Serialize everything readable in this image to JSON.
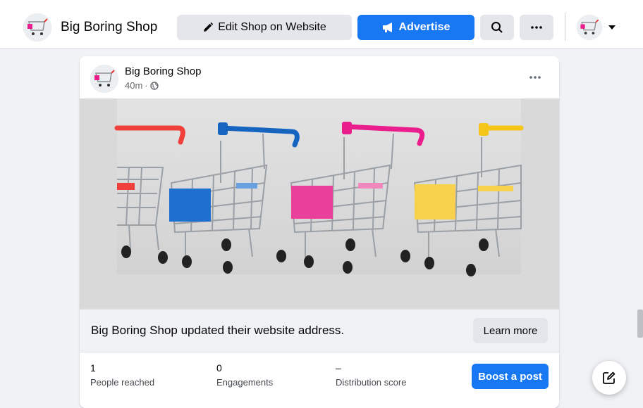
{
  "header": {
    "shop_name": "Big Boring Shop",
    "edit_label": "Edit Shop on Website",
    "advertise_label": "Advertise"
  },
  "post": {
    "author": "Big Boring Shop",
    "time": "40m",
    "dot": "·",
    "link_text": "Big Boring Shop updated their website address.",
    "learn_more_label": "Learn more"
  },
  "stats": [
    {
      "value": "1",
      "label": "People reached"
    },
    {
      "value": "0",
      "label": "Engagements"
    },
    {
      "value": "–",
      "label": "Distribution score"
    }
  ],
  "boost_label": "Boost a post",
  "colors": {
    "accent": "#1877f2",
    "cart_red": "#f0403c",
    "cart_blue": "#1565c0",
    "cart_pink": "#e91e8c",
    "cart_yellow": "#f5c518"
  },
  "icons": [
    "pencil-icon",
    "megaphone-icon",
    "search-icon",
    "more-icon",
    "chevron-down-icon",
    "globe-icon",
    "compose-icon"
  ]
}
